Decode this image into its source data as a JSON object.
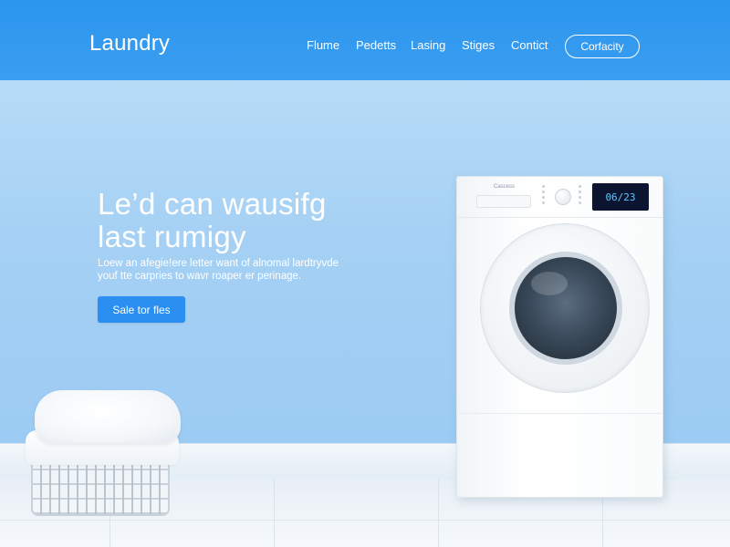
{
  "header": {
    "brand": "Laundry",
    "nav": [
      {
        "label": "Flume"
      },
      {
        "label": "Pedetts"
      },
      {
        "label": "Lasing"
      },
      {
        "label": "Stiges"
      },
      {
        "label": "Contict"
      }
    ],
    "cta_label": "Corfacity"
  },
  "hero": {
    "title_line1": "Le’d can wausifg",
    "title_line2": "last rumigy",
    "subtitle_line1": "Loew an afegie!ere letter want of alnomal lardtryvde",
    "subtitle_line2": "youf tte carpries to wavr roaper er perinage.",
    "button_label": "Sale tor fles"
  },
  "washer": {
    "brand": "Cascess",
    "display": "06/23"
  },
  "colors": {
    "header": "#2b95ee",
    "wall": "#a9d3f4",
    "button": "#2a8ff0"
  }
}
